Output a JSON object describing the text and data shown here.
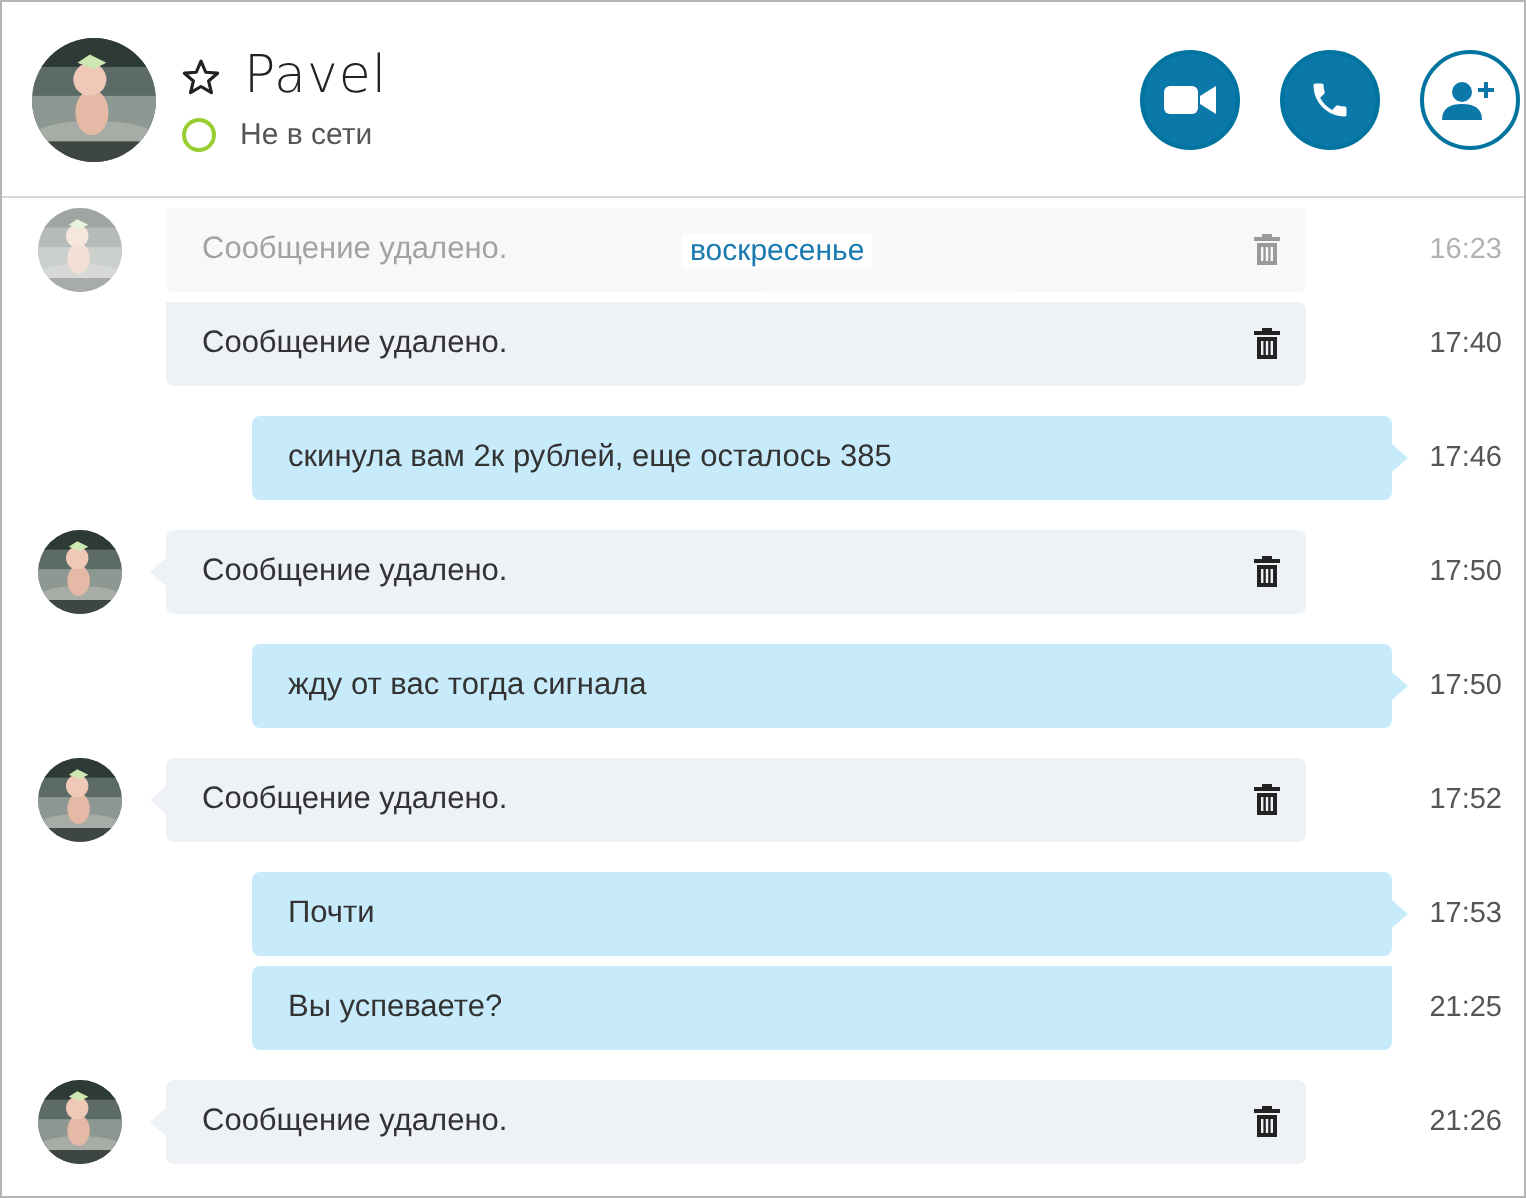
{
  "contact": {
    "name": "Pavel",
    "favorite": false,
    "status": "Не в сети",
    "online": false
  },
  "actions": [
    {
      "kind": "video"
    },
    {
      "kind": "call"
    },
    {
      "kind": "add"
    }
  ],
  "date_divider": "воскресенье",
  "messages": [
    {
      "kind": "incoming",
      "text": "Сообщение удалено.",
      "time": "16:23",
      "deleted": true,
      "faded": true
    },
    {
      "kind": "incoming",
      "text": "Сообщение удалено.",
      "time": "17:40",
      "deleted": true,
      "faded": false
    },
    {
      "kind": "outgoing",
      "text": "скинула вам 2к рублей, еще осталось 385",
      "time": "17:46",
      "deleted": false,
      "faded": false
    },
    {
      "kind": "incoming",
      "text": "Сообщение удалено.",
      "time": "17:50",
      "deleted": true,
      "faded": false
    },
    {
      "kind": "outgoing",
      "text": "жду от вас тогда сигнала",
      "time": "17:50",
      "deleted": false,
      "faded": false
    },
    {
      "kind": "incoming",
      "text": "Сообщение удалено.",
      "time": "17:52",
      "deleted": true,
      "faded": false
    },
    {
      "kind": "outgoing",
      "text": "Почти",
      "time": "17:53",
      "deleted": false,
      "faded": false
    },
    {
      "kind": "outgoing",
      "text": "Вы успеваете?",
      "time": "21:25",
      "deleted": false,
      "faded": false
    },
    {
      "kind": "incoming",
      "text": "Сообщение удалено.",
      "time": "21:26",
      "deleted": true,
      "faded": false
    }
  ]
}
